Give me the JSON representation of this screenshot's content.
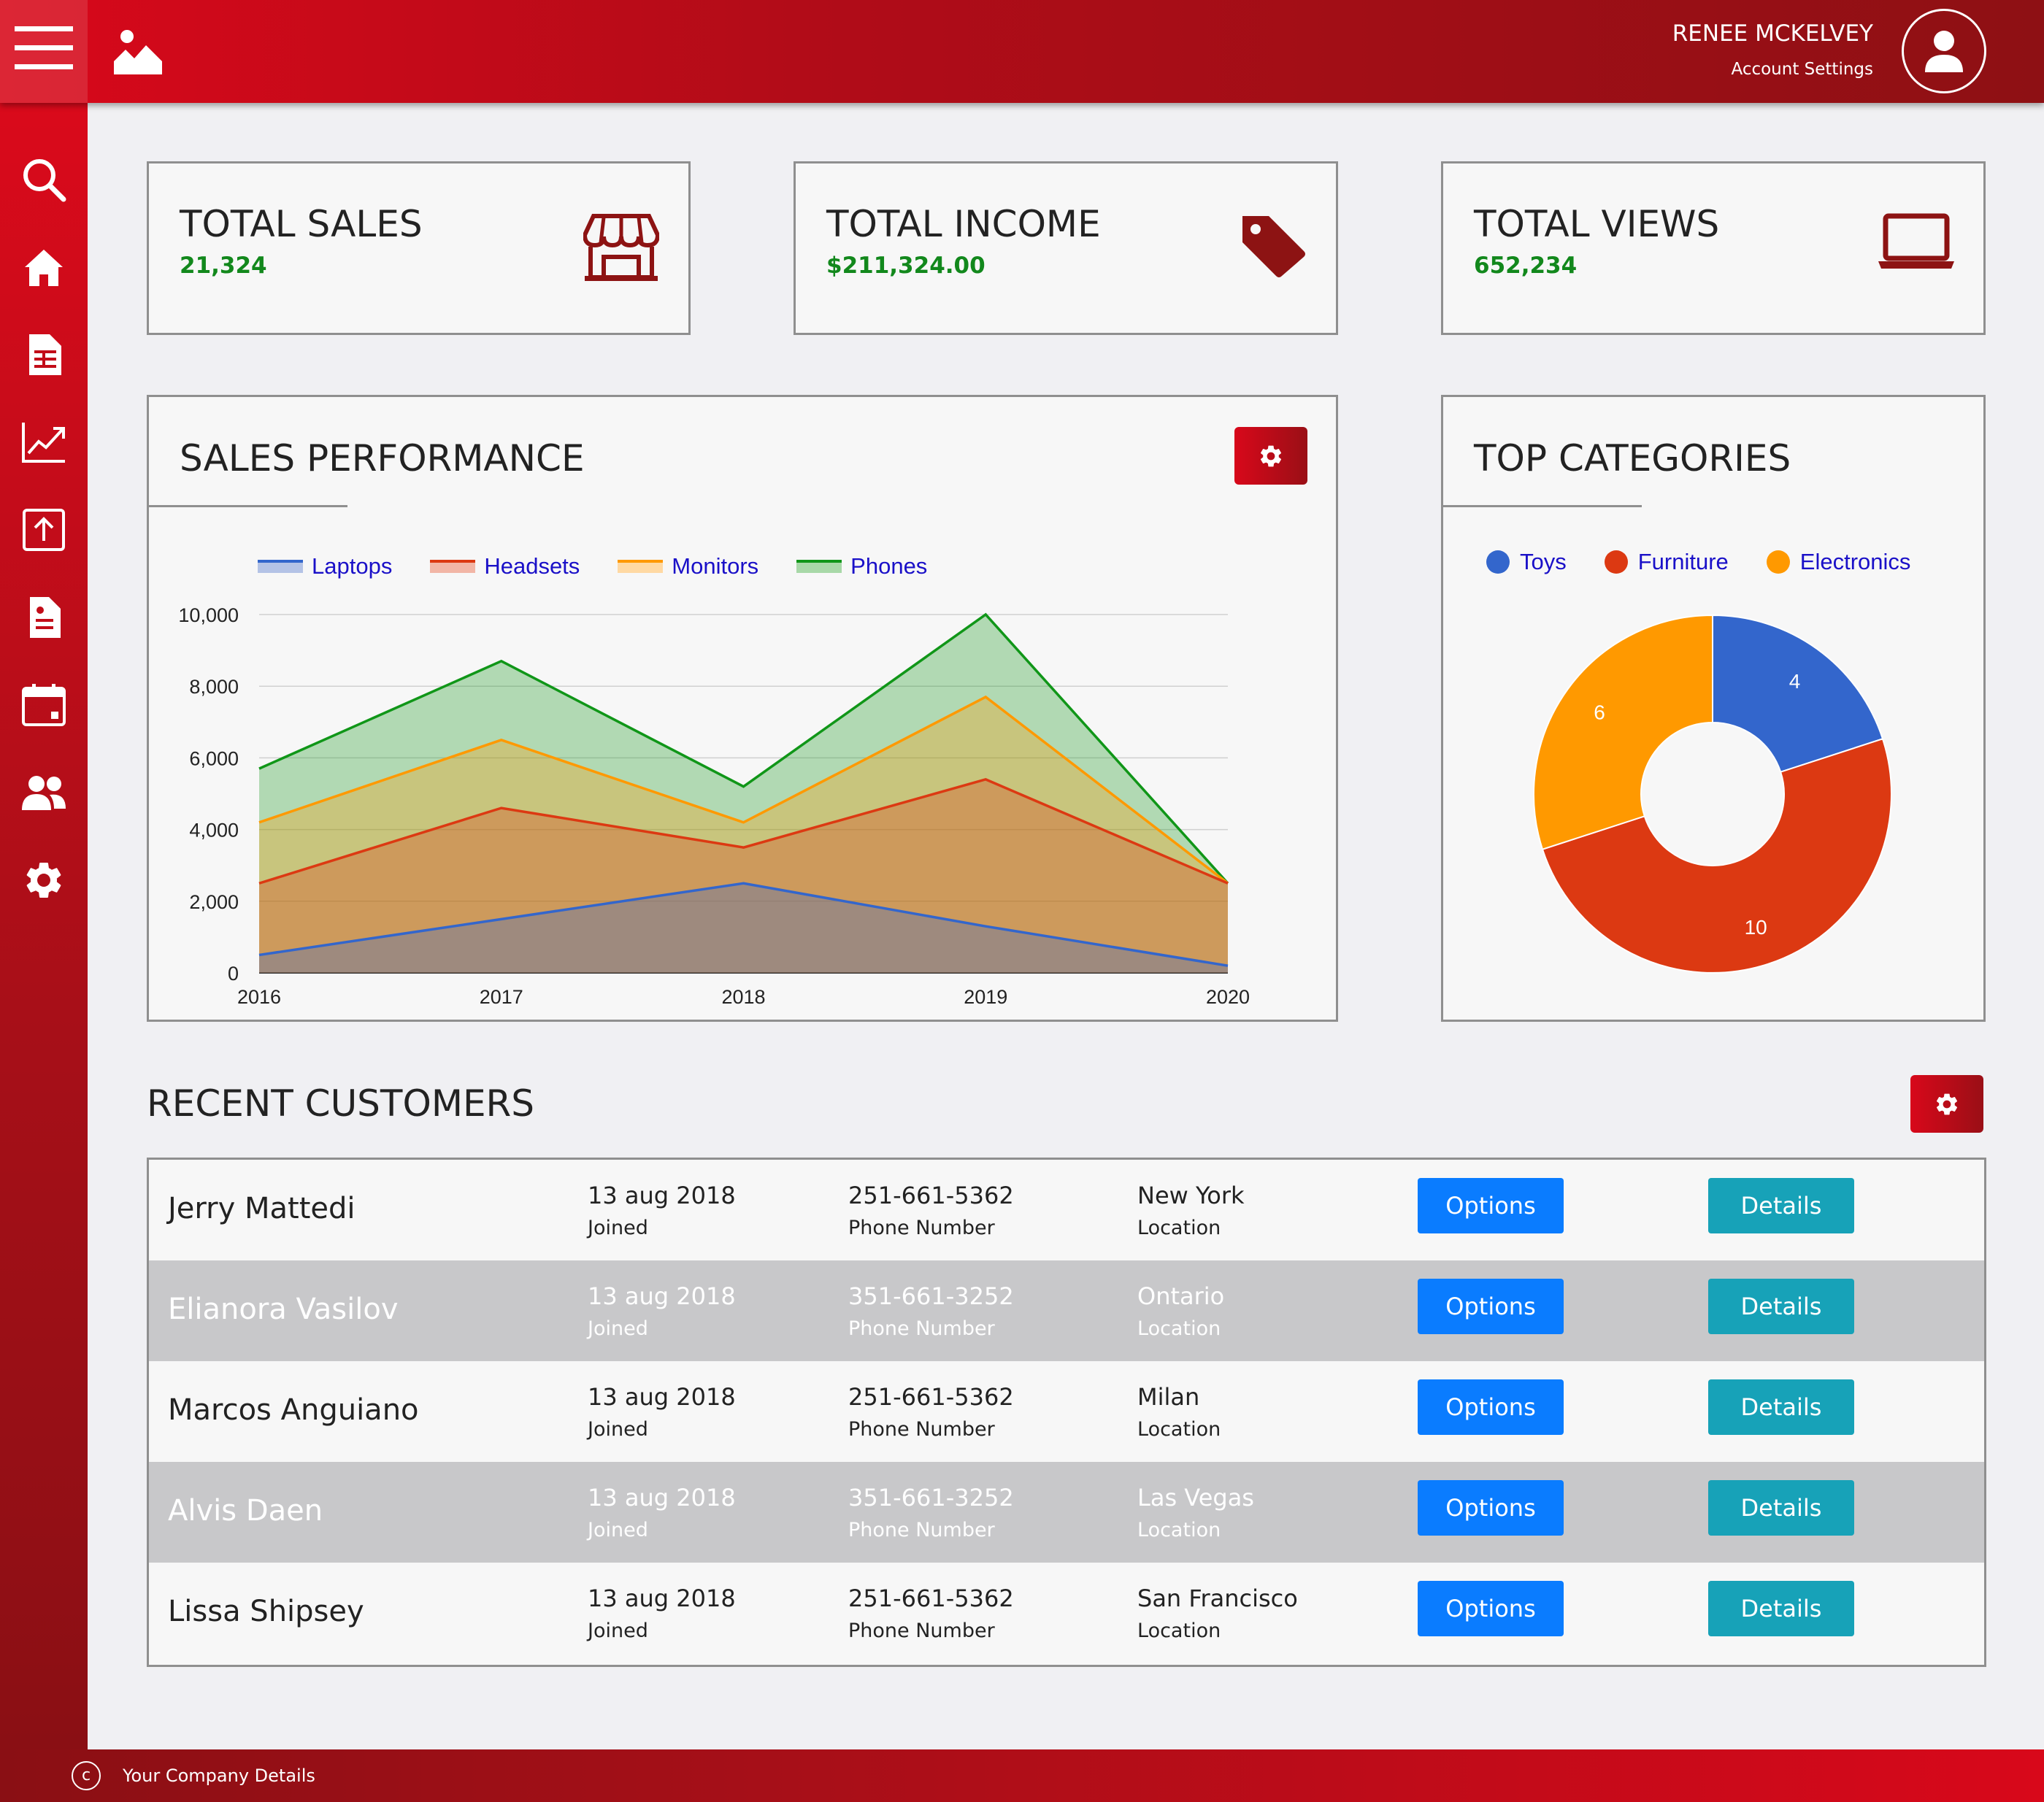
{
  "header": {
    "user_name": "RENEE MCKELVEY",
    "account_settings": "Account Settings",
    "gradient": [
      "#d8081a",
      "#8e1014"
    ],
    "icons": [
      "menu-icon",
      "image-icon",
      "user-icon"
    ]
  },
  "sidebar": {
    "items": [
      {
        "name": "search",
        "icon": "search-icon"
      },
      {
        "name": "home",
        "icon": "home-icon"
      },
      {
        "name": "table",
        "icon": "table-icon"
      },
      {
        "name": "analytics",
        "icon": "chart-line-icon"
      },
      {
        "name": "upload",
        "icon": "upload-icon"
      },
      {
        "name": "reports",
        "icon": "document-icon"
      },
      {
        "name": "calendar",
        "icon": "calendar-icon"
      },
      {
        "name": "users",
        "icon": "users-icon"
      },
      {
        "name": "settings",
        "icon": "gear-icon"
      }
    ]
  },
  "stats": [
    {
      "title": "TOTAL SALES",
      "value": "21,324",
      "icon": "store-icon"
    },
    {
      "title": "TOTAL INCOME",
      "value": "$211,324.00",
      "icon": "tag-icon"
    },
    {
      "title": "TOTAL VIEWS",
      "value": "652,234",
      "icon": "laptop-icon"
    }
  ],
  "sales_performance": {
    "title": "SALES PERFORMANCE",
    "settings_icon": "gear-icon"
  },
  "top_categories": {
    "title": "TOP CATEGORIES"
  },
  "chart_data": [
    {
      "type": "area",
      "x": [
        "2016",
        "2017",
        "2018",
        "2019",
        "2020"
      ],
      "series": [
        {
          "name": "Laptops",
          "values": [
            500,
            1500,
            2500,
            1300,
            200
          ],
          "color": "#3366cc"
        },
        {
          "name": "Headsets",
          "values": [
            2500,
            4600,
            3500,
            5400,
            2500
          ],
          "color": "#dc3912"
        },
        {
          "name": "Monitors",
          "values": [
            4200,
            6500,
            4200,
            7700,
            2500
          ],
          "color": "#ff9900"
        },
        {
          "name": "Phones",
          "values": [
            5700,
            8700,
            5200,
            10000,
            2500
          ],
          "color": "#109618"
        }
      ],
      "y_ticks": [
        "0",
        "2,000",
        "4,000",
        "6,000",
        "8,000",
        "10,000"
      ],
      "ylim": [
        0,
        10000
      ],
      "grid": true,
      "legend": "top"
    },
    {
      "type": "pie",
      "donut": true,
      "labels": [
        "Toys",
        "Furniture",
        "Electronics"
      ],
      "values": [
        4,
        10,
        6
      ],
      "colors": [
        "#3366cc",
        "#dc3912",
        "#ff9900"
      ],
      "legend": "top"
    }
  ],
  "customers": {
    "title": "RECENT CUSTOMERS",
    "settings_icon": "gear-icon",
    "rows": [
      {
        "name": "Jerry Mattedi",
        "date": "13 aug 2018",
        "date_label": "Joined",
        "phone": "251-661-5362",
        "phone_label": "Phone Number",
        "location": "New York",
        "location_label": "Location",
        "options": "Options",
        "details": "Details"
      },
      {
        "name": "Elianora Vasilov",
        "date": "13 aug 2018",
        "date_label": "Joined",
        "phone": "351-661-3252",
        "phone_label": "Phone Number",
        "location": "Ontario",
        "location_label": "Location",
        "options": "Options",
        "details": "Details"
      },
      {
        "name": "Marcos Anguiano",
        "date": "13 aug 2018",
        "date_label": "Joined",
        "phone": "251-661-5362",
        "phone_label": "Phone Number",
        "location": "Milan",
        "location_label": "Location",
        "options": "Options",
        "details": "Details"
      },
      {
        "name": "Alvis Daen",
        "date": "13 aug 2018",
        "date_label": "Joined",
        "phone": "351-661-3252",
        "phone_label": "Phone Number",
        "location": "Las Vegas",
        "location_label": "Location",
        "options": "Options",
        "details": "Details"
      },
      {
        "name": "Lissa Shipsey",
        "date": "13 aug 2018",
        "date_label": "Joined",
        "phone": "251-661-5362",
        "phone_label": "Phone Number",
        "location": "San Francisco",
        "location_label": "Location",
        "options": "Options",
        "details": "Details"
      }
    ]
  },
  "footer": {
    "copyright_icon": "copyright-icon",
    "text": "Your Company Details"
  }
}
